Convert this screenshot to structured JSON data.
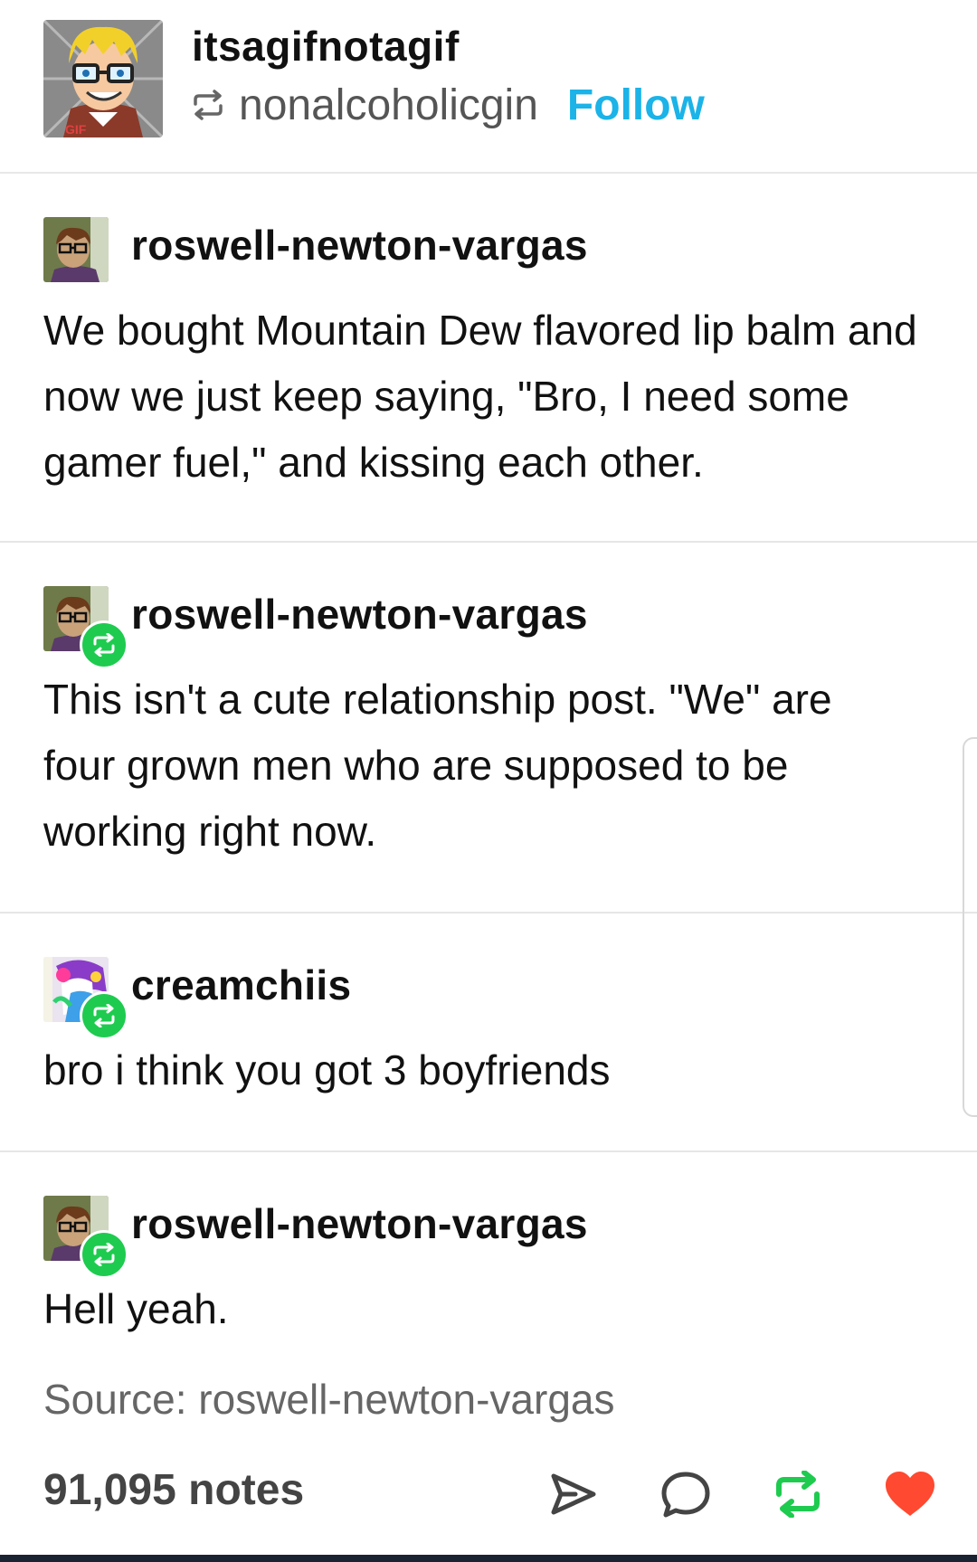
{
  "header": {
    "username": "itsagifnotagif",
    "reblogged_from": "nonalcoholicgin",
    "follow_label": "Follow",
    "avatar_text": "GIF"
  },
  "posts": [
    {
      "username": "roswell-newton-vargas",
      "text": "We bought Mountain Dew flavored lip balm and now we just keep saying, \"Bro, I need some gamer fuel,\" and kissing each other.",
      "is_reblog": false
    },
    {
      "username": "roswell-newton-vargas",
      "text": "This isn't a cute relationship post. \"We\" are four grown men who are supposed to be working right now.",
      "is_reblog": true
    },
    {
      "username": "creamchiis",
      "text": "bro i think you got 3 boyfriends",
      "is_reblog": true
    },
    {
      "username": "roswell-newton-vargas",
      "text": "Hell yeah.",
      "is_reblog": true
    }
  ],
  "source": "Source: roswell-newton-vargas",
  "footer": {
    "notes": "91,095 notes",
    "icons": [
      "share-icon",
      "reply-icon",
      "reblog-icon",
      "like-icon"
    ]
  },
  "colors": {
    "follow": "#1bb3e8",
    "reblog_green": "#1ecb4f",
    "like_red": "#ff4930"
  }
}
